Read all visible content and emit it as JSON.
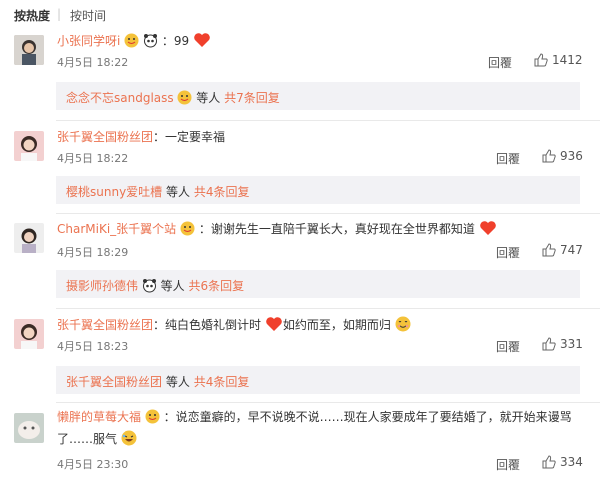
{
  "sort": {
    "hot": "按热度",
    "separator": "|",
    "time": "按时间"
  },
  "comments": [
    {
      "name": "小张同学呀i",
      "text": "：99",
      "time": "4月5日 18:22",
      "reply": "回覆",
      "likes": "1412",
      "sub": {
        "name": "念念不忘sandglass",
        "etc": "等人",
        "count": "共7条回复"
      }
    },
    {
      "name": "张千翼全国粉丝团",
      "text": "：一定要幸福",
      "time": "4月5日 18:22",
      "reply": "回覆",
      "likes": "936",
      "sub": {
        "name": "樱桃sunny爱吐槽",
        "etc": "等人",
        "count": "共4条回复"
      }
    },
    {
      "name": "CharMiKi_张千翼个站",
      "text": "：谢谢先生一直陪千翼长大，真好现在全世界都知道",
      "time": "4月5日 18:29",
      "reply": "回覆",
      "likes": "747",
      "sub": {
        "name": "摄影师孙德伟",
        "etc": "等人",
        "count": "共6条回复"
      }
    },
    {
      "name": "张千翼全国粉丝团",
      "text": "：纯白色婚礼倒计时",
      "text2": "如约而至，如期而归",
      "time": "4月5日 18:23",
      "reply": "回覆",
      "likes": "331",
      "sub": {
        "name": "张千翼全国粉丝团",
        "etc": "等人",
        "count": "共4条回复"
      }
    },
    {
      "name": "懒胖的草莓大福",
      "text": "：说恋童癖的，早不说晚不说……现在人家要成年了要结婚了，就开始来谩骂",
      "text_line2": "了……服气",
      "time": "4月5日 23:30",
      "reply": "回覆",
      "likes": "334"
    }
  ],
  "colors": {
    "name": "#eb7350",
    "text": "#333333",
    "meta": "#777777",
    "sub_bg": "#f2f2f5"
  },
  "icons": [
    "thumb-up-icon",
    "heart-emoji",
    "panda-emoji",
    "wedding-emoji",
    "smile-emoji",
    "laugh-emoji"
  ]
}
